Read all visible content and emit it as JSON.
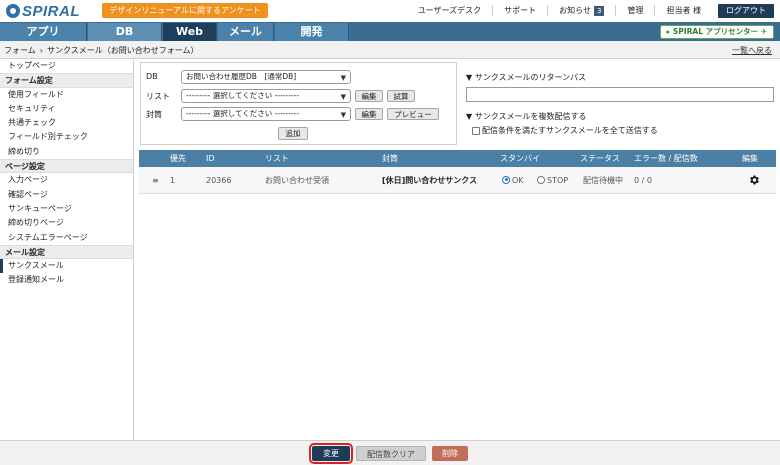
{
  "header": {
    "logo_text": "SPIRAL",
    "survey_button": "デザインリニューアルに関するアンケート",
    "links": {
      "user_desk": "ユーザーズデスク",
      "support": "サポート",
      "notice": "お知らせ",
      "notice_count": "3",
      "admin": "管理",
      "user": "担当者 様"
    },
    "logout": "ログアウト"
  },
  "tabs": {
    "app": "アプリ",
    "db": "DB",
    "web": "Web",
    "mail": "メール",
    "dev": "開発",
    "app_center": "SPIRAL アプリセンター"
  },
  "breadcrumb": {
    "parent": "フォーム",
    "current": "サンクスメール（お問い合わせフォーム）",
    "back": "一覧へ戻る"
  },
  "sidebar": {
    "top": "トップページ",
    "form_settings": "フォーム設定",
    "used_fields": "使用フィールド",
    "security": "セキュリティ",
    "common_check": "共通チェック",
    "field_check": "フィールド別チェック",
    "deadline": "締め切り",
    "page_settings": "ページ設定",
    "input_page": "入力ページ",
    "confirm_page": "確認ページ",
    "thanks_page": "サンキューページ",
    "deadline_page": "締め切りページ",
    "system_error_page": "システムエラーページ",
    "mail_settings": "メール設定",
    "thanks_mail": "サンクスメール",
    "registration_mail": "登録通知メール"
  },
  "config": {
    "db_label": "DB",
    "db_value": "お問い合わせ履歴DB　[通常DB]",
    "list_label": "リスト",
    "list_value": "--------- 選択してください ---------",
    "envelope_label": "封筒",
    "envelope_value": "--------- 選択してください ---------",
    "edit": "編集",
    "trial": "試算",
    "edit2": "編集",
    "preview": "プレビュー",
    "add": "追加"
  },
  "return_path": {
    "title": "▼ サンクスメールのリターンパス",
    "value": ""
  },
  "multi_send": {
    "title": "▼ サンクスメールを複数配信する",
    "checkbox_label": "配信条件を満たすサンクスメールを全て送信する",
    "checked": false
  },
  "table": {
    "headers": {
      "priority": "優先",
      "id": "ID",
      "list": "リスト",
      "envelope": "封筒",
      "standby": "スタンバイ",
      "status": "ステータス",
      "errors": "エラー数 / 配信数",
      "edit": "編集"
    },
    "rows": [
      {
        "handle": "≡",
        "priority": "1",
        "id": "20366",
        "list": "お問い合わせ受領",
        "envelope": "[休日]問い合わせサンクス",
        "ok": "OK",
        "stop": "STOP",
        "standby": "OK",
        "status": "配信待機中",
        "errors": "0 / 0"
      }
    ]
  },
  "footer": {
    "change": "変更",
    "clear_count": "配信数クリア",
    "delete": "削除"
  },
  "colors": {
    "tab_active": "#1d3f5c",
    "accent_orange": "#f0911e",
    "table_header": "#4c7fa6",
    "delete": "#c26d58",
    "highlight": "#e02020"
  }
}
